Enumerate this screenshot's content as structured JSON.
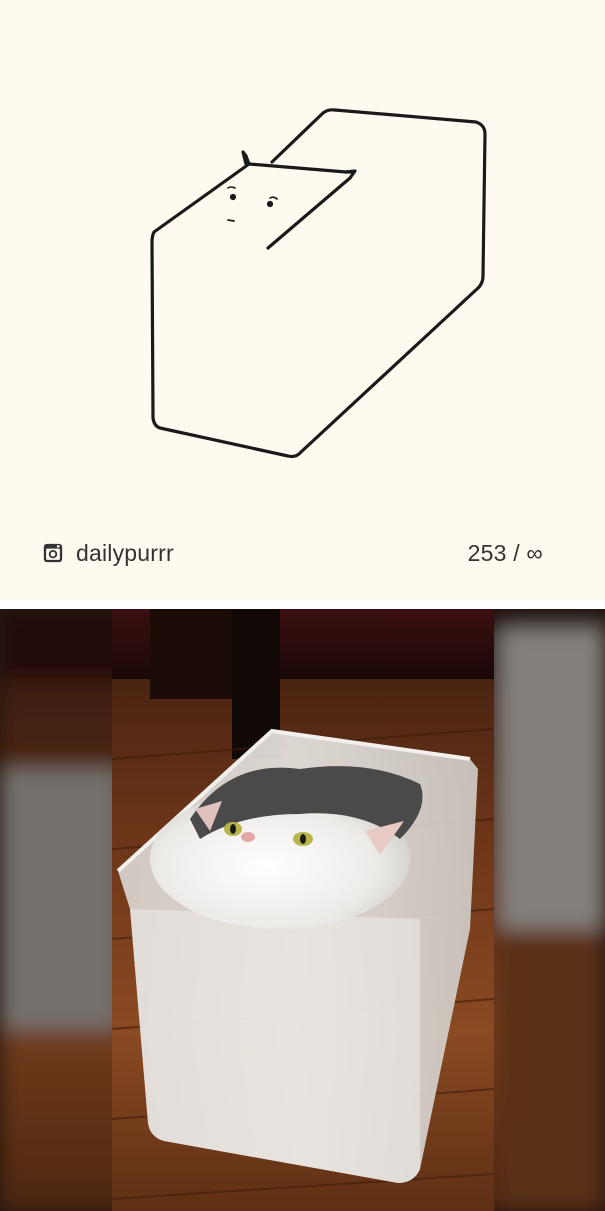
{
  "card": {
    "source_handle": "dailypurrr",
    "counter": "253 / ∞"
  },
  "icons": {
    "source_icon": "instagram-icon"
  },
  "photo": {
    "alt": ""
  },
  "colors": {
    "card_background": "#fefaf0",
    "ink": "#1a1a1a",
    "footer_text": "#333333"
  }
}
